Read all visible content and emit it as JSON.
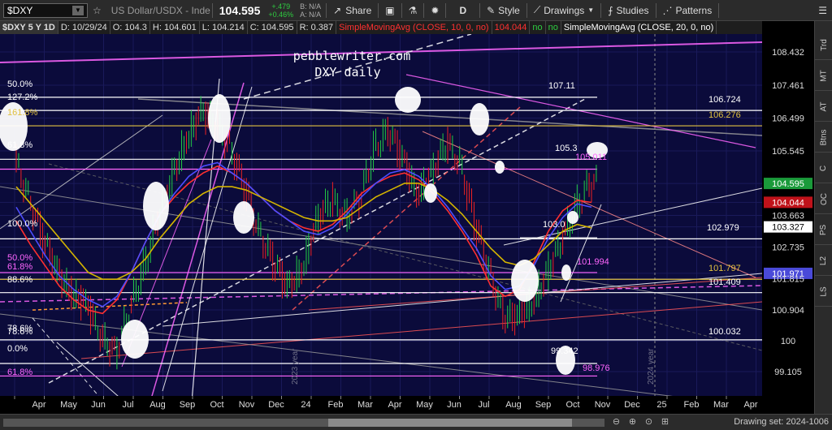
{
  "toolbar": {
    "symbol": "$DXY",
    "description": "US Dollar/USDX - Inde...",
    "last": "104.595",
    "change": "+.479",
    "change_pct": "+0.46%",
    "bid": "B: N/A",
    "ask": "A: N/A",
    "share_label": "Share",
    "period": "D",
    "style_label": "Style",
    "drawings_label": "Drawings",
    "studies_label": "Studies",
    "patterns_label": "Patterns"
  },
  "infobar": {
    "symbol": "$DXY 5 Y 1D",
    "date": "D: 10/29/24",
    "open": "O: 104.3",
    "high": "H: 104.601",
    "low": "L: 104.214",
    "close": "C: 104.595",
    "range": "R: 0.387",
    "sma1": "SimpleMovingAvg (CLOSE, 10, 0, no)",
    "sma1_value": "104.044",
    "no1": "no",
    "no2": "no",
    "sma2": "SimpleMovingAvg (CLOSE, 20, 0, no)"
  },
  "chart_data": {
    "type": "line",
    "title": "pebblewriter.com",
    "subtitle": "DXY daily",
    "watermark_text": "2023 year",
    "watermark_text2": "2024 year",
    "price_ticks": [
      "108.432",
      "107.461",
      "106.499",
      "105.545",
      "104.595",
      "104.044",
      "103.663",
      "103.327",
      "102.735",
      "101.971",
      "101.815",
      "100.904",
      "100",
      "99.105"
    ],
    "price_tags": [
      {
        "label": "104.595",
        "color": "#1a9a3a"
      },
      {
        "label": "104.044",
        "color": "#c0121a"
      },
      {
        "label": "103.327",
        "color": "#ffffff"
      },
      {
        "label": "101.971",
        "color": "#4a4ad8"
      }
    ],
    "time_labels": [
      "Apr",
      "May",
      "Jun",
      "Jul",
      "Aug",
      "Sep",
      "Oct",
      "Nov",
      "Dec",
      "24",
      "Feb",
      "Mar",
      "Apr",
      "May",
      "Jun",
      "Jul",
      "Aug",
      "Sep",
      "Oct",
      "Nov",
      "Dec",
      "25",
      "Feb",
      "Mar",
      "Apr"
    ],
    "fib_labels_left": [
      {
        "text": "50.0%",
        "color": "#ffffff"
      },
      {
        "text": "127.2%",
        "color": "#ffffff"
      },
      {
        "text": "161.8%",
        "color": "#e0c040"
      },
      {
        "text": "61.8%",
        "color": "#ffffff"
      },
      {
        "text": "78.6%",
        "color": "#ffffff"
      },
      {
        "text": "100.0%",
        "color": "#ffffff"
      },
      {
        "text": "50.0%",
        "color": "#ff66ff"
      },
      {
        "text": "61.8%",
        "color": "#ff66ff"
      },
      {
        "text": "88.6%",
        "color": "#ffffff"
      },
      {
        "text": "78.6%",
        "color": "#ffffff"
      },
      {
        "text": "0.0%",
        "color": "#ffffff"
      },
      {
        "text": "61.8%",
        "color": "#ff66ff"
      }
    ],
    "level_labels": [
      {
        "text": "107.11",
        "color": "#ffffff"
      },
      {
        "text": "106.724",
        "color": "#ffffff"
      },
      {
        "text": "106.276",
        "color": "#e0c040"
      },
      {
        "text": "105.3",
        "color": "#ffffff"
      },
      {
        "text": "105.011",
        "color": "#ff66ff"
      },
      {
        "text": "103.0",
        "color": "#ffffff"
      },
      {
        "text": "102.979",
        "color": "#ffffff"
      },
      {
        "text": "101.994",
        "color": "#ff66ff"
      },
      {
        "text": "101.797",
        "color": "#e0c040"
      },
      {
        "text": "101.409",
        "color": "#ffffff"
      },
      {
        "text": "100.032",
        "color": "#ffffff"
      },
      {
        "text": "99.342",
        "color": "#ffffff"
      },
      {
        "text": "98.976",
        "color": "#ff66ff"
      }
    ],
    "series": [
      {
        "name": "",
        "color": "#ff3030",
        "values": [
          103.5,
          102.8,
          102.2,
          101.6,
          101.2,
          100.9,
          100.8,
          101.2,
          102.0,
          102.9,
          103.7,
          104.2,
          104.6,
          104.9,
          105.1,
          104.9,
          104.6,
          104.2,
          103.8,
          103.5,
          103.3,
          103.2,
          103.4,
          103.8,
          104.3,
          104.6,
          104.8,
          104.9,
          104.7,
          104.3,
          103.8,
          103.2,
          102.5,
          101.6,
          101.3,
          101.5,
          102.3,
          103.2,
          103.8,
          104.1,
          104.04
        ]
      },
      {
        "name": "",
        "color": "#4d4dff",
        "values": [
          103.9,
          103.2,
          102.5,
          101.9,
          101.5,
          101.2,
          101.0,
          101.3,
          102.0,
          102.9,
          103.7,
          104.3,
          104.8,
          105.1,
          105.2,
          104.9,
          104.6,
          104.2,
          103.8,
          103.5,
          103.2,
          103.1,
          103.3,
          103.7,
          104.2,
          104.6,
          104.9,
          105.0,
          104.8,
          104.4,
          103.9,
          103.3,
          102.7,
          101.9,
          101.5,
          101.6,
          102.2,
          103.0,
          103.6,
          104.0,
          103.9
        ]
      },
      {
        "name": "",
        "color": "#d4b400",
        "values": [
          104.5,
          104.0,
          103.5,
          103.0,
          102.5,
          102.0,
          101.8,
          101.8,
          102.0,
          102.4,
          103.0,
          103.5,
          104.0,
          104.3,
          104.5,
          104.5,
          104.4,
          104.2,
          104.0,
          103.8,
          103.6,
          103.5,
          103.5,
          103.6,
          103.9,
          104.2,
          104.4,
          104.6,
          104.6,
          104.4,
          104.1,
          103.7,
          103.2,
          102.7,
          102.3,
          102.2,
          102.4,
          102.8,
          103.2,
          103.4,
          103.3
        ]
      }
    ],
    "close_values": [
      105.3,
      104.2,
      102.9,
      102.0,
      101.4,
      101.0,
      100.2,
      99.6,
      100.9,
      102.2,
      103.6,
      104.8,
      106.0,
      106.6,
      106.4,
      105.6,
      104.4,
      103.2,
      102.3,
      101.5,
      102.2,
      103.4,
      104.2,
      103.6,
      104.1,
      105.6,
      106.2,
      105.2,
      104.4,
      104.8,
      105.8,
      105.2,
      103.4,
      102.0,
      100.8,
      100.6,
      101.2,
      101.9,
      102.9,
      103.9,
      104.595
    ]
  },
  "sidebar": {
    "tabs": [
      "Trd",
      "MT",
      "AT",
      "Btns",
      "C",
      "OC",
      "PS",
      "L2",
      "LS"
    ]
  },
  "bottombar": {
    "drawing_set": "Drawing set: 2024-1006"
  }
}
